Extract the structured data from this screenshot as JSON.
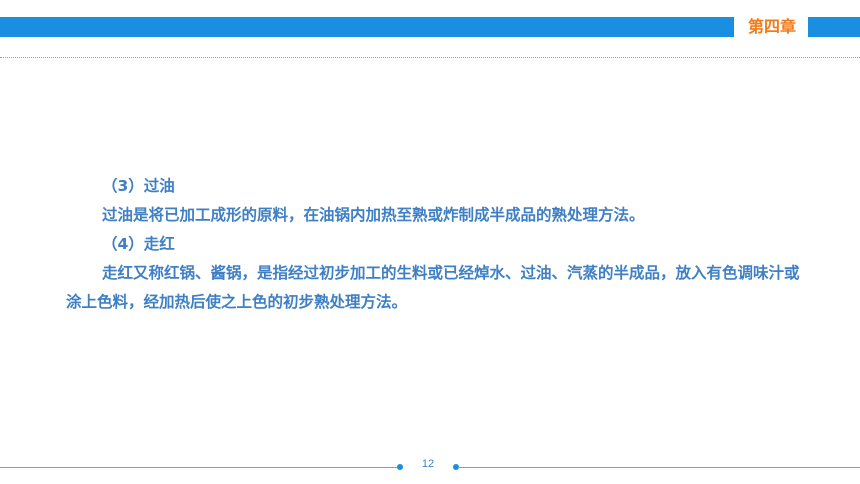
{
  "header": {
    "chapter_label": "第四章",
    "accent_color": "#1a8ee0",
    "chapter_color": "#f07b1c"
  },
  "content": {
    "paragraphs": [
      "（3）过油",
      "过油是将已加工成形的原料，在油锅内加热至熟或炸制成半成品的熟处理方法。",
      "（4）走红",
      "走红又称红锅、酱锅，是指经过初步加工的生料或已经焯水、过油、汽蒸的半成品，放入有色调味汁或涂上色料，经加热后使之上色的初步熟处理方法。"
    ],
    "text_color": "#3f7fc4"
  },
  "footer": {
    "page_number": "12"
  }
}
